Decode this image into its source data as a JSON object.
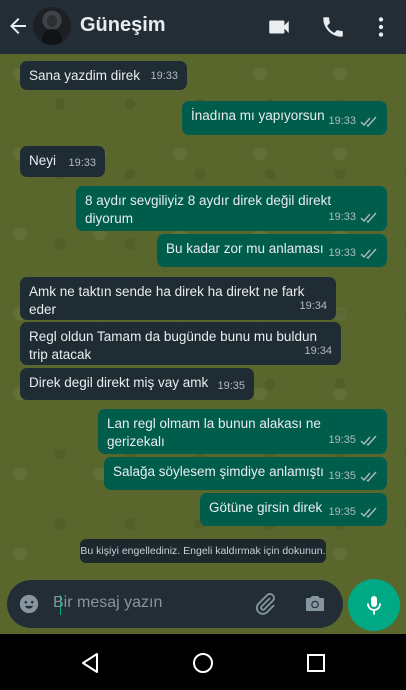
{
  "header": {
    "title": "Güneşim"
  },
  "messages": [
    {
      "text": "Sana yazdim direk",
      "time": "19:33"
    },
    {
      "text": "İnadına mı yapıyorsun",
      "time": "19:33"
    },
    {
      "text": "Neyi",
      "time": "19:33"
    },
    {
      "text": "8 aydır sevgiliyiz 8 aydır direk değil direkt diyorum",
      "time": "19:33"
    },
    {
      "text": "Bu kadar zor mu anlaması",
      "time": "19:33"
    },
    {
      "text": "Amk ne taktın sende ha direk ha direkt ne fark eder",
      "time": "19:34"
    },
    {
      "text": "Regl oldun Tamam da bugünde bunu mu buldun trip atacak",
      "time": "19:34"
    },
    {
      "text": "Direk degil direkt miş vay amk",
      "time": "19:35"
    },
    {
      "text": "Lan regl olmam la bunun alakası ne gerizekalı",
      "time": "19:35"
    },
    {
      "text": "Salağa söylesem şimdiye anlamıştı",
      "time": "19:35"
    },
    {
      "text": "Götüne girsin direk",
      "time": "19:35"
    }
  ],
  "system_message": "Bu kişiyi engellediniz. Engeli kaldırmak için dokunun.",
  "input": {
    "placeholder": "Bir mesaj yazın"
  }
}
